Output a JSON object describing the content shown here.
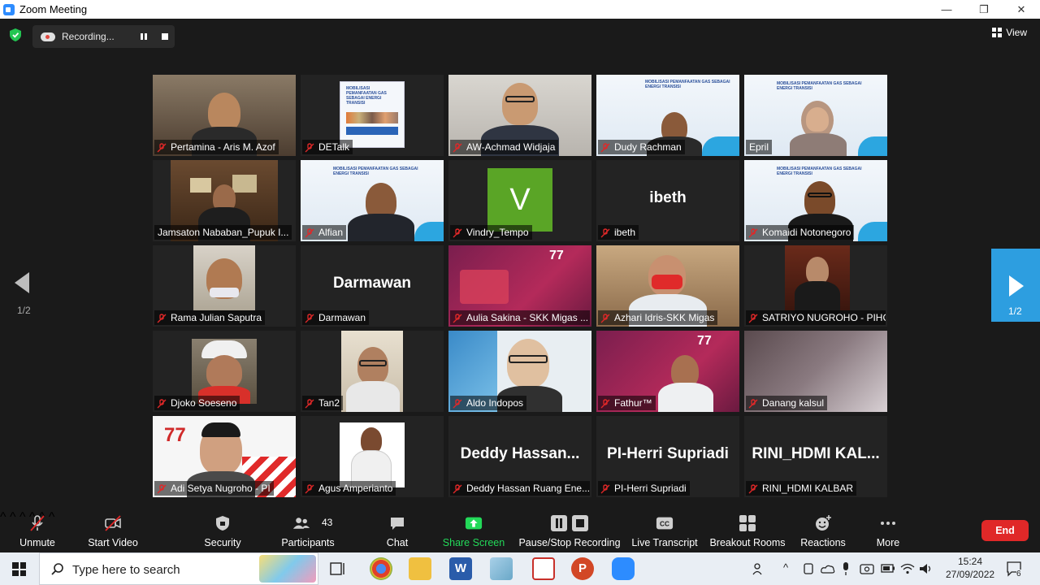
{
  "window": {
    "title": "Zoom Meeting",
    "controls": [
      "—",
      "❐",
      "✕"
    ]
  },
  "recording": {
    "label": "Recording...",
    "pause_icon": "pause-icon",
    "stop_icon": "stop-icon"
  },
  "view": {
    "label": "View"
  },
  "pagination": {
    "left_page": "1/2",
    "right_page": "1/2"
  },
  "tiles": [
    {
      "name": "Pertamina - Aris M. Azof"
    },
    {
      "name": "DETalk"
    },
    {
      "name": "AW-Achmad Widjaja"
    },
    {
      "name": "Dudy Rachman"
    },
    {
      "name": "Epril"
    },
    {
      "name": "Jamsaton Nababan_Pupuk I..."
    },
    {
      "name": "Alfian"
    },
    {
      "name": "Vindry_Tempo",
      "avatar_letter": "V"
    },
    {
      "name": "ibeth",
      "big_name": "ibeth"
    },
    {
      "name": "Komaidi Notonegoro"
    },
    {
      "name": "Rama Julian Saputra"
    },
    {
      "name": "Darmawan",
      "big_name": "Darmawan"
    },
    {
      "name": "Aulia Sakina - SKK Migas ..."
    },
    {
      "name": "Azhari Idris-SKK Migas"
    },
    {
      "name": "SATRIYO NUGROHO - PIHC"
    },
    {
      "name": "Djoko Soeseno"
    },
    {
      "name": "Tan2"
    },
    {
      "name": "Aldo Indopos"
    },
    {
      "name": "Fathur™"
    },
    {
      "name": "Danang kalsul"
    },
    {
      "name": "Adi Setya Nugroho - PI"
    },
    {
      "name": "Agus Amperianto"
    },
    {
      "name": "Deddy Hassan Ruang Ene...",
      "big_name": "Deddy Hassan..."
    },
    {
      "name": "PI-Herri Supriadi",
      "big_name": "PI-Herri Supriadi"
    },
    {
      "name": "RINI_HDMI KALBAR",
      "big_name": "RINI_HDMI KAL..."
    }
  ],
  "slide_text": {
    "banner": "MOBILISASI PEMANFAATAN GAS SEBAGAI ENERGI TRANSISI",
    "brand": "energy",
    "detalk_banner": "MOBILISASI PEMANFAATAN GAS SEBAGAI ENERGI TRANSISI"
  },
  "toolbar": {
    "unmute": "Unmute",
    "start_video": "Start Video",
    "security": "Security",
    "participants": "Participants",
    "participants_count": "43",
    "chat": "Chat",
    "share_screen": "Share Screen",
    "pause_stop_recording": "Pause/Stop Recording",
    "live_transcript": "Live Transcript",
    "breakout_rooms": "Breakout Rooms",
    "reactions": "Reactions",
    "more": "More",
    "end": "End"
  },
  "taskbar": {
    "search_placeholder": "Type here to search",
    "time": "15:24",
    "date": "27/09/2022",
    "notification_count": "6"
  },
  "colors": {
    "active_speaker": "#c7e34b",
    "share_green": "#23d959",
    "end_red": "#e02828",
    "nav_blue": "#2d9ee0",
    "vindry_green": "#5aa526"
  }
}
